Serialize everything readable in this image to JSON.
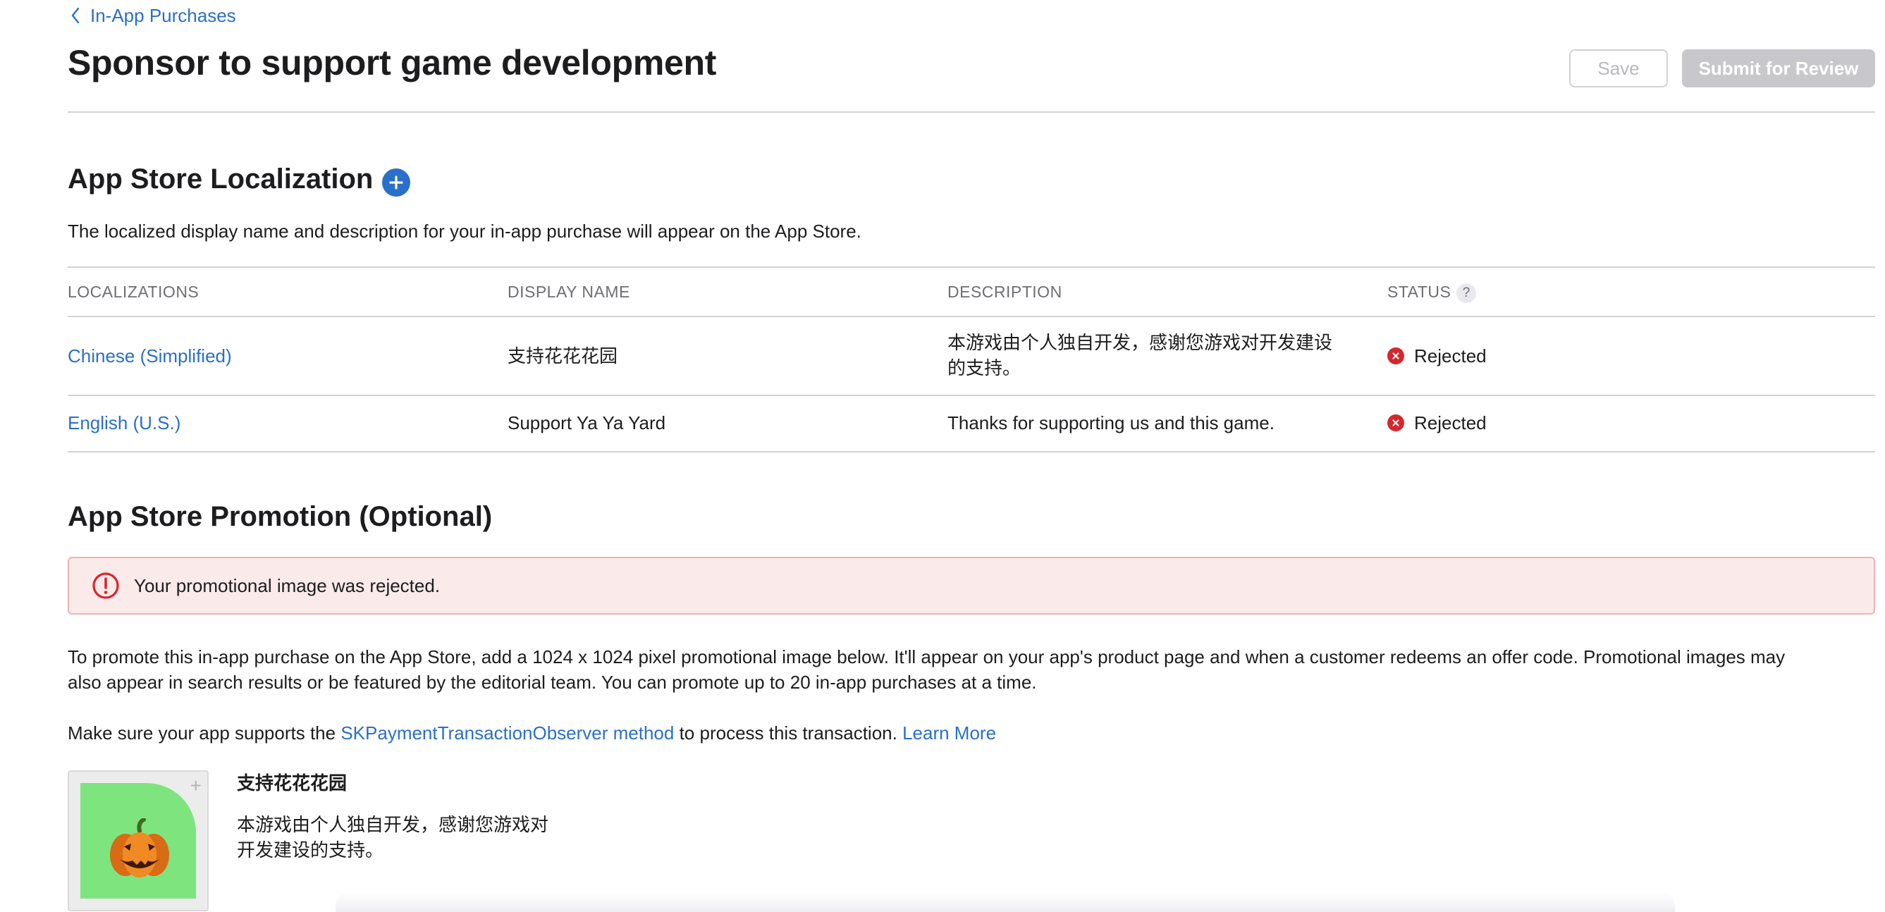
{
  "breadcrumb": {
    "label": "In-App Purchases"
  },
  "header": {
    "title": "Sponsor to support game development",
    "save_label": "Save",
    "submit_label": "Submit for Review"
  },
  "localization": {
    "title": "App Store Localization",
    "description": "The localized display name and description for your in-app purchase will appear on the App Store.",
    "columns": [
      "LOCALIZATIONS",
      "DISPLAY NAME",
      "DESCRIPTION",
      "STATUS"
    ],
    "status_help": "?",
    "rows": [
      {
        "locale": "Chinese (Simplified)",
        "display_name": "支持花花花园",
        "description": "本游戏由个人独自开发，感谢您游戏对开发建设的支持。",
        "status": "Rejected"
      },
      {
        "locale": "English (U.S.)",
        "display_name": "Support Ya Ya Yard",
        "description": "Thanks for supporting us and this game.",
        "status": "Rejected"
      }
    ]
  },
  "promotion": {
    "title": "App Store Promotion (Optional)",
    "alert": "Your promotional image was rejected.",
    "info_line1": "To promote this in-app purchase on the App Store, add a 1024 x 1024 pixel promotional image below. It'll appear on your app's product page and when a customer redeems an offer code. Promotional images may",
    "info_line2": "also appear in search results or be featured by the editorial team. You can promote up to 20 in-app purchases at a time.",
    "observer_prefix": "Make sure your app supports the ",
    "observer_link": "SKPaymentTransactionObserver method",
    "observer_suffix": " to process this transaction. ",
    "learn_more": "Learn More",
    "preview_name": "支持花花花园",
    "preview_description": "本游戏由个人独自开发，感谢您游戏对开发建设的支持。",
    "plus_glyph": "+"
  },
  "icons": {
    "back": "chevron-left-icon",
    "add": "plus-circle-icon",
    "rejected": "x-circle-icon",
    "alert": "exclamation-circle-icon",
    "image": "pumpkin-icon"
  },
  "colors": {
    "accent": "#2a6fc9",
    "error": "#d8262c",
    "alert_bg": "#fbeaea",
    "promo_bg": "#7ee47d"
  }
}
